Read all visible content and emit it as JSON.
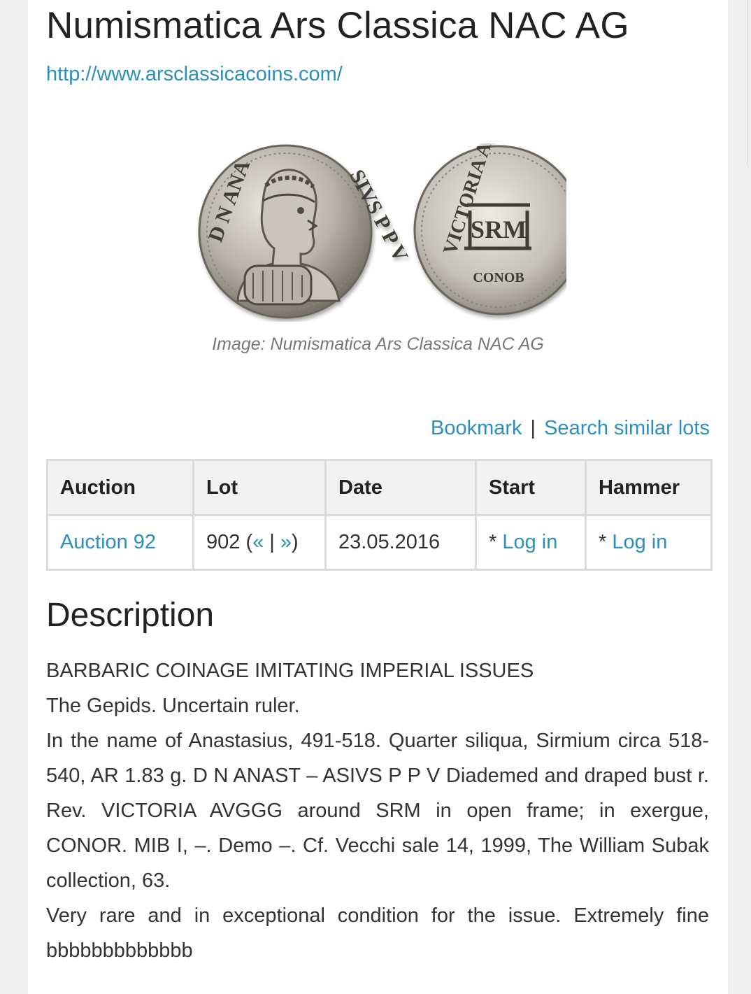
{
  "header": {
    "title": "Numismatica Ars Classica NAC AG",
    "url": "http://www.arsclassicacoins.com/"
  },
  "image": {
    "caption": "Image: Numismatica Ars Classica NAC AG",
    "obverse_legend_left": "D N ANA",
    "obverse_legend_right": "SIVS P P V",
    "reverse_legend": "VICTORIA AVGGG",
    "reverse_center": "SRM",
    "reverse_exergue": "CONOB"
  },
  "actions": {
    "bookmark": "Bookmark",
    "separator": "|",
    "search_similar": "Search similar lots"
  },
  "lot_table": {
    "headers": [
      "Auction",
      "Lot",
      "Date",
      "Start",
      "Hammer"
    ],
    "auction": "Auction 92",
    "lot_number": "902 (",
    "lot_prev": "«",
    "lot_sep": " | ",
    "lot_next": "»",
    "lot_close": ")",
    "date": "23.05.2016",
    "start_prefix": "* ",
    "start_link": "Log in",
    "hammer_prefix": "* ",
    "hammer_link": "Log in"
  },
  "description": {
    "heading": "Description",
    "lines": [
      "BARBARIC COINAGE IMITATING IMPERIAL ISSUES",
      "The Gepids. Uncertain ruler.",
      "In the name of Anastasius, 491-518. Quarter siliqua, Sirmium circa 518-540, AR 1.83 g. D N ANAST – ASIVS P P V Diademed and draped bust r. Rev. VICTORIA AVGGG around SRM in open frame; in exergue, CONOR. MIB I, –. Demo –. Cf. Vecchi sale 14, 1999, The William Subak collection, 63.",
      "Very rare and in exceptional condition for the issue. Extremely fine bbbbbbbbbbbbb"
    ]
  }
}
